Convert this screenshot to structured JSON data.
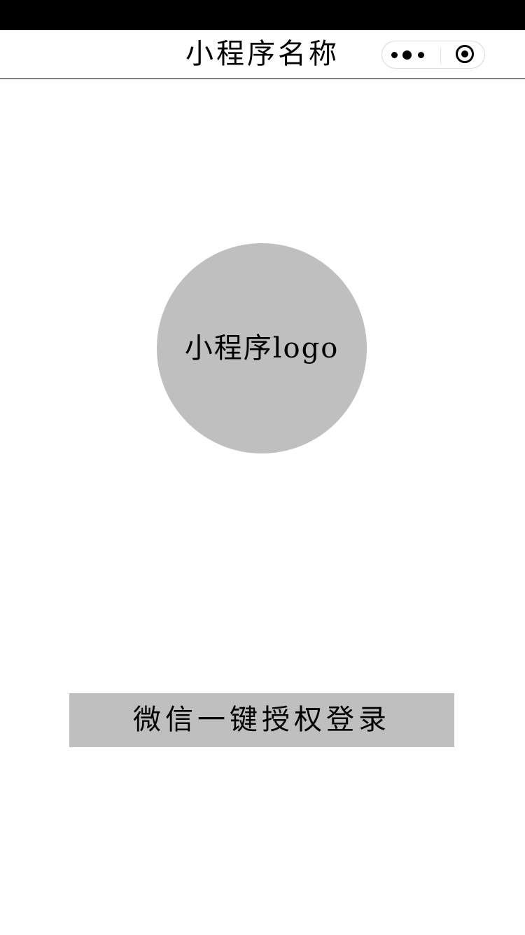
{
  "nav": {
    "title": "小程序名称",
    "more_icon": "more-dots-icon",
    "close_icon": "target-close-icon"
  },
  "logo": {
    "label": "小程序logo",
    "fill_color": "#bfbfbf"
  },
  "login": {
    "button_label": "微信一键授权登录",
    "button_color": "#bfbfbf"
  },
  "colors": {
    "status_bar": "#000000",
    "background": "#ffffff",
    "text": "#000000"
  }
}
